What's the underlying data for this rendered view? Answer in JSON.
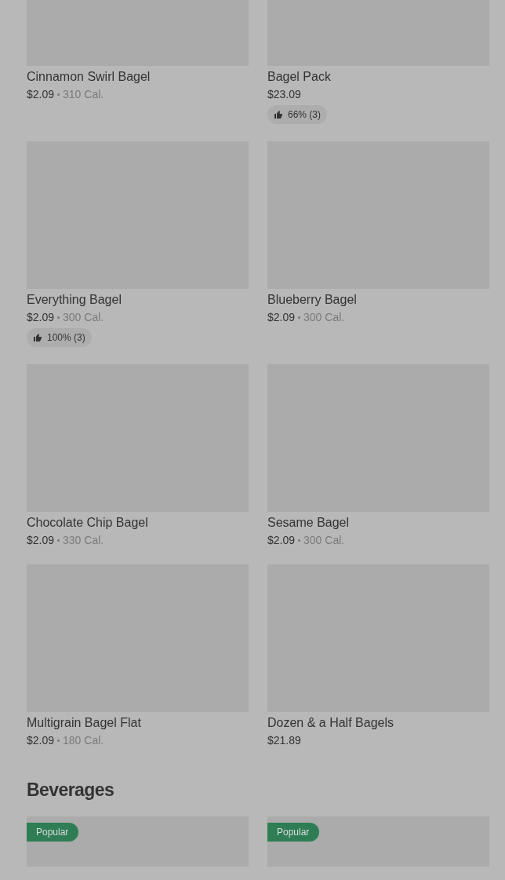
{
  "sections": [
    {
      "items": [
        {
          "name": "Cinnamon Swirl Bagel",
          "price": "$2.09",
          "calories": "310 Cal."
        },
        {
          "name": "Bagel Pack",
          "price": "$23.09",
          "rating": "66% (3)"
        },
        {
          "name": "Everything Bagel",
          "price": "$2.09",
          "calories": "300 Cal.",
          "rating": "100% (3)"
        },
        {
          "name": "Blueberry Bagel",
          "price": "$2.09",
          "calories": "300 Cal."
        },
        {
          "name": "Chocolate Chip Bagel",
          "price": "$2.09",
          "calories": "330 Cal."
        },
        {
          "name": "Sesame Bagel",
          "price": "$2.09",
          "calories": "300 Cal."
        },
        {
          "name": "Multigrain Bagel Flat",
          "price": "$2.09",
          "calories": "180 Cal."
        },
        {
          "name": "Dozen & a Half Bagels",
          "price": "$21.89"
        }
      ]
    },
    {
      "title": "Beverages",
      "items": [
        {
          "badge": "Popular"
        },
        {
          "badge": "Popular"
        }
      ]
    }
  ]
}
